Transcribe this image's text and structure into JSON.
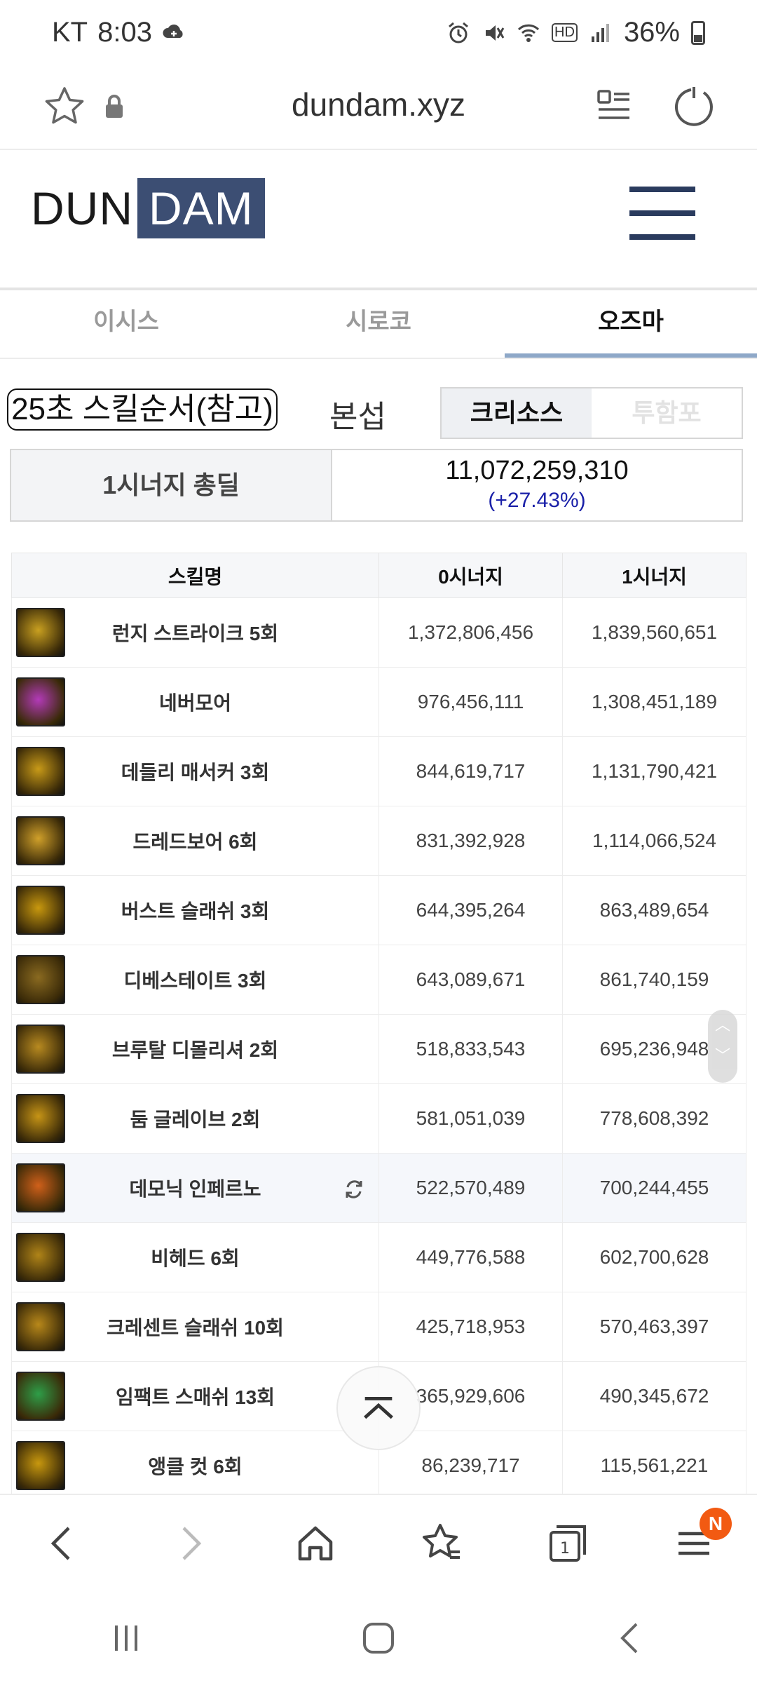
{
  "status_bar": {
    "carrier": "KT",
    "time": "8:03",
    "network": "HD",
    "battery": "36%"
  },
  "address_bar": {
    "url": "dundam.xyz"
  },
  "site": {
    "logo_left": "DUN",
    "logo_right": "DAM"
  },
  "server_tabs": [
    {
      "label": "이시스",
      "active": false
    },
    {
      "label": "시로코",
      "active": false
    },
    {
      "label": "오즈마",
      "active": true
    }
  ],
  "skill_order": {
    "button_label": "25초 스킬순서(참고)",
    "mode_label": "본섭",
    "options": [
      {
        "label": "크리소스",
        "active": true
      },
      {
        "label": "투함포",
        "active": false
      }
    ]
  },
  "total": {
    "label": "1시너지 총딜",
    "value": "11,072,259,310",
    "change": "(+27.43%)"
  },
  "table": {
    "headers": [
      "스킬명",
      "0시너지",
      "1시너지"
    ],
    "rows": [
      {
        "name": "런지 스트라이크 5회",
        "s0": "1,372,806,456",
        "s1": "1,839,560,651",
        "icon": "lunge-strike-icon",
        "color": "#c9a020"
      },
      {
        "name": "네버모어",
        "s0": "976,456,111",
        "s1": "1,308,451,189",
        "icon": "nevermore-icon",
        "color": "#b33ab8"
      },
      {
        "name": "데들리 매서커 3회",
        "s0": "844,619,717",
        "s1": "1,131,790,421",
        "icon": "deadly-massacre-icon",
        "color": "#c89a18"
      },
      {
        "name": "드레드보어 6회",
        "s0": "831,392,928",
        "s1": "1,114,066,524",
        "icon": "dreadbore-icon",
        "color": "#d0a02a"
      },
      {
        "name": "버스트 슬래쉬 3회",
        "s0": "644,395,264",
        "s1": "863,489,654",
        "icon": "burst-slash-icon",
        "color": "#c8980e"
      },
      {
        "name": "디베스테이트 3회",
        "s0": "643,089,671",
        "s1": "861,740,159",
        "icon": "devastate-icon",
        "color": "#8a6a20"
      },
      {
        "name": "브루탈 디몰리셔 2회",
        "s0": "518,833,543",
        "s1": "695,236,948",
        "icon": "brutal-demolisher-icon",
        "color": "#b88a20"
      },
      {
        "name": "둠 글레이브 2회",
        "s0": "581,051,039",
        "s1": "778,608,392",
        "icon": "doom-glaive-icon",
        "color": "#c69416"
      },
      {
        "name": "데모닉 인페르노",
        "s0": "522,570,489",
        "s1": "700,244,455",
        "icon": "demonic-inferno-icon",
        "color": "#d0601a",
        "highlight": true
      },
      {
        "name": "비헤드 6회",
        "s0": "449,776,588",
        "s1": "602,700,628",
        "icon": "behead-icon",
        "color": "#b08418"
      },
      {
        "name": "크레센트 슬래쉬 10회",
        "s0": "425,718,953",
        "s1": "570,463,397",
        "icon": "crescent-slash-icon",
        "color": "#b8881a"
      },
      {
        "name": "임팩트 스매쉬 13회",
        "s0": "365,929,606",
        "s1": "490,345,672",
        "icon": "impact-smash-icon",
        "color": "#2e9e48"
      },
      {
        "name": "앵클 컷 6회",
        "s0": "86,239,717",
        "s1": "115,561,221",
        "icon": "ankle-cut-icon",
        "color": "#c8980e"
      }
    ]
  },
  "bottom_nav": {
    "badge": "N",
    "tabs_count": "1"
  },
  "colors": {
    "brand": "#3c4e73",
    "tab_underline": "#8ea8c8",
    "change_text": "#1a20a8",
    "badge": "#f25a12"
  }
}
